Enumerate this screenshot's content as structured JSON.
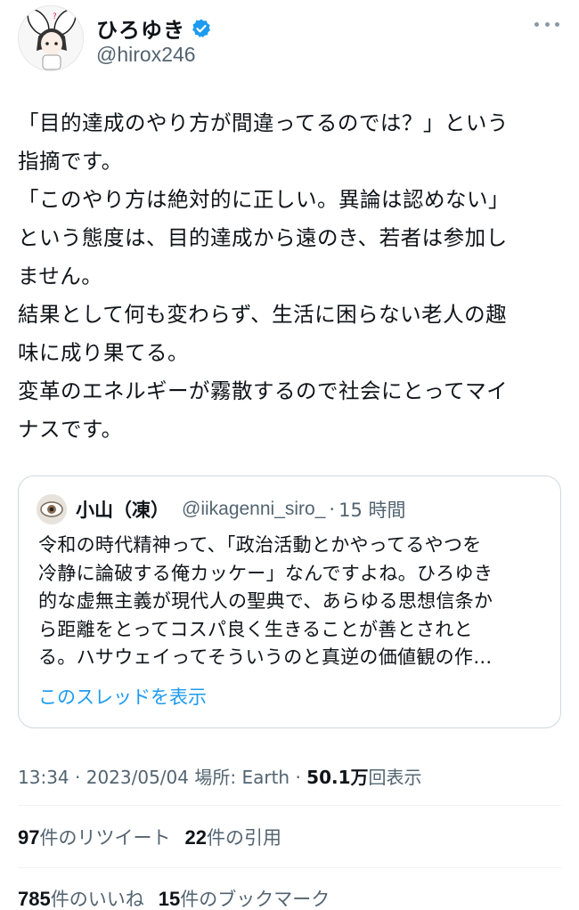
{
  "user": {
    "display_name": "ひろゆき",
    "handle": "@hirox246",
    "avatar_icon": "rabbit-ear-avatar",
    "verified_icon": "verified-badge-icon"
  },
  "tweet": {
    "text": "「目的達成のやり方が間違ってるのでは？」という\n指摘です。\n「このやり方は絶対的に正しい。異論は認めない」\nという態度は、目的達成から遠のき、若者は参加し\nません。\n結果として何も変わらず、生活に困らない老人の趣\n味に成り果てる。\n変革のエネルギーが霧散するので社会にとってマイ\nナスです。"
  },
  "quote": {
    "display_name": "小山（凍）",
    "handle": "@iikagenni_siro_",
    "separator": "·",
    "time": "15 時間",
    "text": "令和の時代精神って、「政治活動とかやってるやつを\n冷静に論破する俺カッケー」なんですよね。ひろゆき\n的な虚無主義が現代人の聖典で、あらゆる思想信条か\nら距離をとってコスパ良く生きることが善とされと\nる。ハサウェイってそういうのと真逆の価値観の作…",
    "show_thread": "このスレッドを表示"
  },
  "meta": {
    "time": "13:34",
    "date": "2023/05/04",
    "location": "場所: Earth",
    "views_count": "50.1万",
    "views_label": "回表示"
  },
  "stats": {
    "retweets_count": "97",
    "retweets_label": "件のリツイート",
    "quotes_count": "22",
    "quotes_label": "件の引用",
    "likes_count": "785",
    "likes_label": "件のいいね",
    "bookmarks_count": "15",
    "bookmarks_label": "件のブックマーク"
  },
  "colors": {
    "accent": "#1d9bf0",
    "secondary_text": "#536471",
    "border": "#cfd9de"
  }
}
